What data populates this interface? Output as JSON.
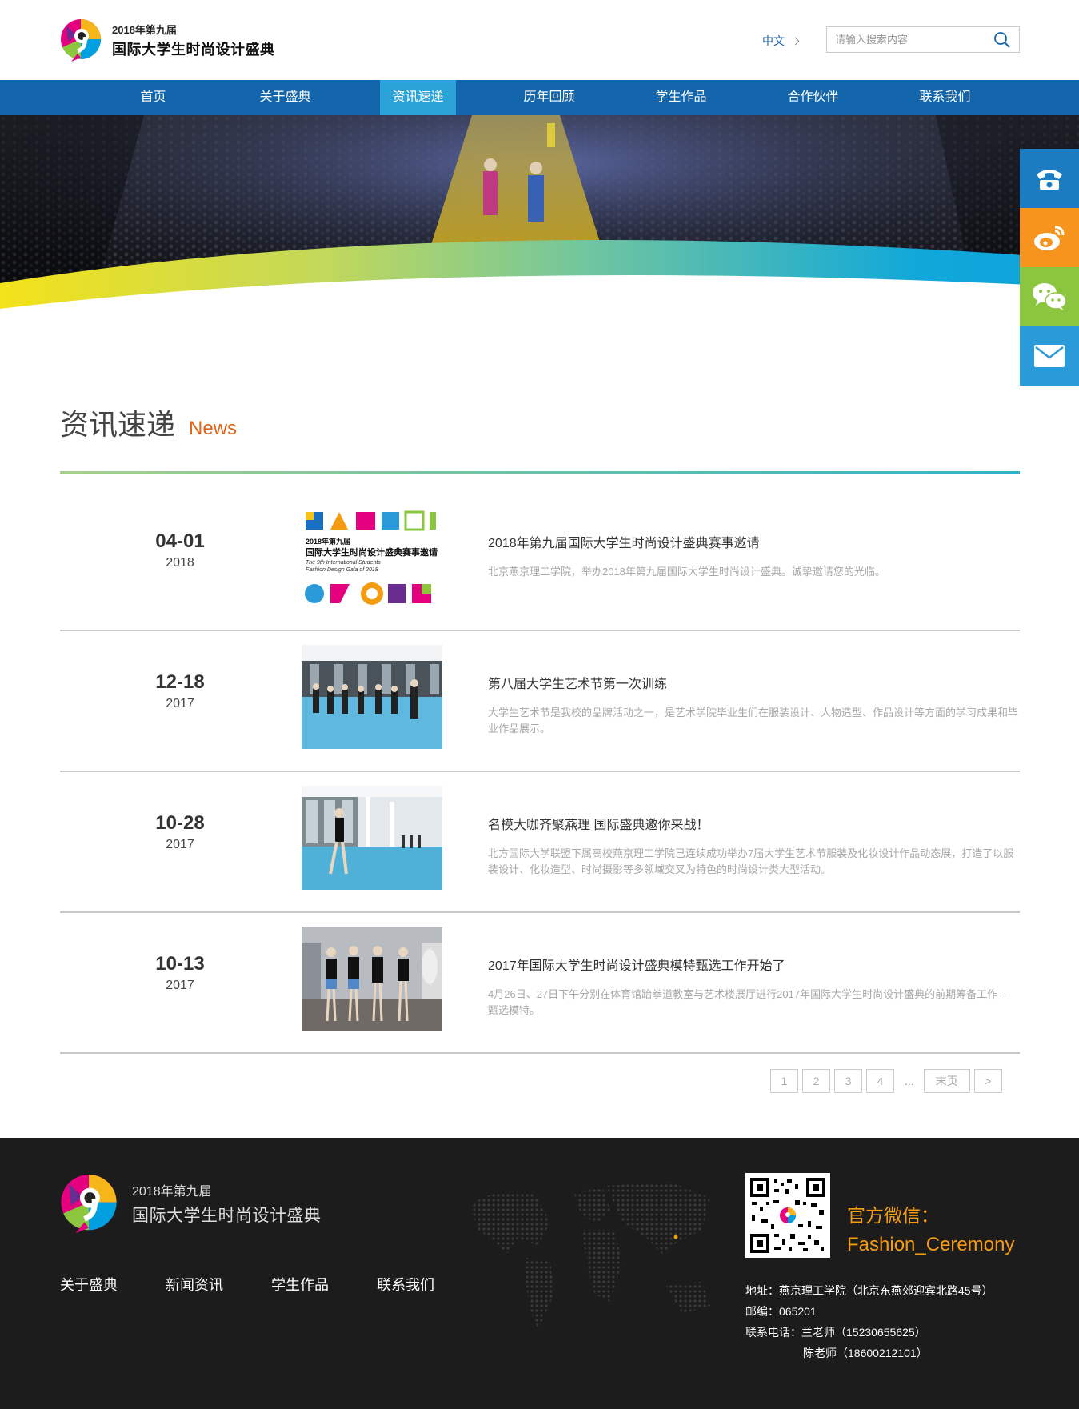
{
  "header": {
    "logo_line1": "2018年第九届",
    "logo_line2": "国际大学生时尚设计盛典",
    "lang": "中文",
    "search_placeholder": "请输入搜索内容"
  },
  "nav": {
    "items": [
      "首页",
      "关于盛典",
      "资讯速递",
      "历年回顾",
      "学生作品",
      "合作伙伴",
      "联系我们"
    ],
    "active_index": 2
  },
  "section": {
    "title_cn": "资讯速递",
    "title_en": "News"
  },
  "news": [
    {
      "md": "04-01",
      "year": "2018",
      "title": "2018年第九届国际大学生时尚设计盛典赛事邀请",
      "desc": "北京燕京理工学院，举办2018年第九届国际大学生时尚设计盛典。诚挚邀请您的光临。",
      "poster_line1": "2018年第九届",
      "poster_line2": "国际大学生时尚设计盛典赛事邀请",
      "poster_line3": "The 9th International Students",
      "poster_line4": "Fashion Design Gala of 2018"
    },
    {
      "md": "12-18",
      "year": "2017",
      "title": "第八届大学生艺术节第一次训练",
      "desc": "大学生艺术节是我校的品牌活动之一，是艺术学院毕业生们在服装设计、人物造型、作品设计等方面的学习成果和毕业作品展示。"
    },
    {
      "md": "10-28",
      "year": "2017",
      "title": "名模大咖齐聚燕理 国际盛典邀你来战！",
      "desc": "北方国际大学联盟下属高校燕京理工学院已连续成功举办7届大学生艺术节服装及化妆设计作品动态展，打造了以服装设计、化妆造型、时尚摄影等多领域交叉为特色的时尚设计类大型活动。"
    },
    {
      "md": "10-13",
      "year": "2017",
      "title": "2017年国际大学生时尚设计盛典模特甄选工作开始了",
      "desc": "4月26日、27日下午分别在体育馆跆拳道教室与艺术楼展厅进行2017年国际大学生时尚设计盛典的前期筹备工作----甄选模特。"
    }
  ],
  "pager": {
    "pages": [
      "1",
      "2",
      "3",
      "4"
    ],
    "ellipsis": "...",
    "last": "末页",
    "next": ">"
  },
  "footer": {
    "logo_line1": "2018年第九届",
    "logo_line2": "国际大学生时尚设计盛典",
    "links": [
      "关于盛典",
      "新闻资讯",
      "学生作品",
      "联系我们"
    ],
    "wechat_label": "官方微信：",
    "wechat_id": "Fashion_Ceremony",
    "address": "地址：燕京理工学院（北京东燕郊迎宾北路45号）",
    "postcode": "邮编：065201",
    "phone1": "联系电话：兰老师（15230655625）",
    "phone2": "陈老师（18600212101）"
  },
  "colors": {
    "nav_bg": "#1466ac",
    "nav_active": "#2ba3d9",
    "accent_orange": "#e0641b",
    "side_phone": "#1c7cc1",
    "side_weibo": "#f7941d",
    "side_wechat": "#8cc63f",
    "side_mail": "#2a9ad8",
    "footer_bg": "#1c1c1c",
    "wechat_text": "#f39c12"
  },
  "icons": [
    "search-icon",
    "phone-icon",
    "weibo-icon",
    "wechat-icon",
    "mail-icon",
    "chevron-right-icon"
  ]
}
